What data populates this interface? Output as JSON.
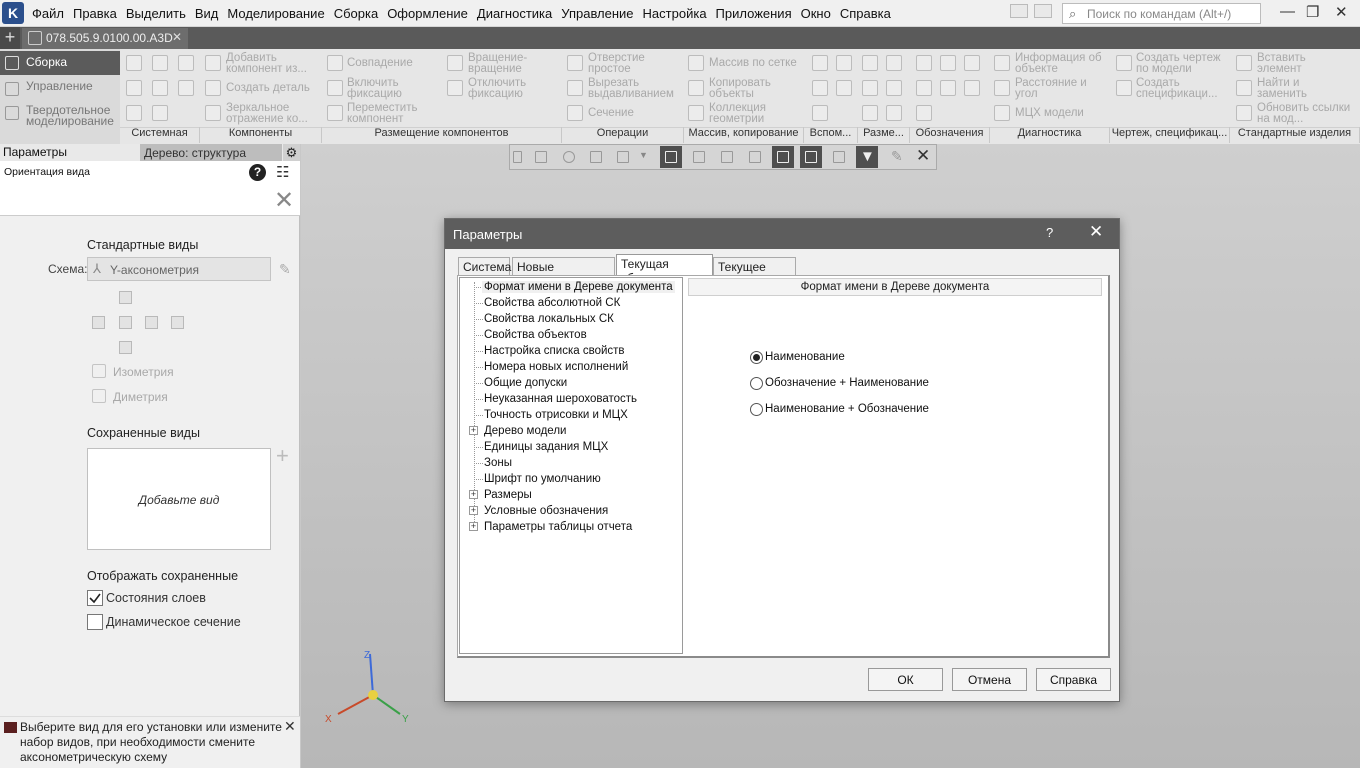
{
  "menubar": {
    "items": [
      "Файл",
      "Правка",
      "Выделить",
      "Вид",
      "Моделирование",
      "Сборка",
      "Оформление",
      "Диагностика",
      "Управление",
      "Настройка",
      "Приложения",
      "Окно",
      "Справка"
    ],
    "search_placeholder": "Поиск по командам (Alt+/)"
  },
  "doc_tab": {
    "label": "078.505.9.0100.00.A3D"
  },
  "leftnav": {
    "items": [
      "Сборка",
      "Управление",
      "Твердотельное моделирование"
    ]
  },
  "ribbon": {
    "commands": {
      "c1": "Добавить компонент из...",
      "c2": "Создать деталь",
      "c3": "Зеркальное отражение ко...",
      "c4": "Совпадение",
      "c5": "Включить фиксацию",
      "c6": "Переместить компонент",
      "c7": "Вращение-вращение",
      "c8": "Отключить фиксацию",
      "c9": "Отверстие простое",
      "c10": "Вырезать выдавливанием",
      "c11": "Сечение",
      "c12": "Массив по сетке",
      "c13": "Копировать объекты",
      "c14": "Коллекция геометрии",
      "c15": "Информация об объекте",
      "c16": "Расстояние и угол",
      "c17": "МЦХ модели",
      "c18": "Создать чертеж по модели",
      "c19": "Создать спецификаци...",
      "c20": "Вставить элемент",
      "c21": "Найти и заменить",
      "c22": "Обновить ссылки на мод..."
    },
    "groups": [
      "Системная",
      "Компоненты",
      "Размещение компонентов",
      "Операции",
      "Массив, копирование",
      "Вспом...",
      "Разме...",
      "Обозначения",
      "Диагностика",
      "Чертеж, спецификац...",
      "Стандартные изделия"
    ]
  },
  "left_panel": {
    "title": "Параметры",
    "tree_tab": "Дерево: структура",
    "subtitle": "Ориентация вида",
    "std_views": "Стандартные виды",
    "schema_label": "Схема:",
    "schema_value": "Y-аксонометрия",
    "isometry": "Изометрия",
    "dimetry": "Диметрия",
    "saved_views": "Сохраненные виды",
    "add_view": "Добавьте вид",
    "show_saved": "Отображать сохраненные",
    "cb_layers": "Состояния слоев",
    "cb_dynamic": "Динамическое сечение",
    "hint": "Выберите вид для его установки или измените набор видов, при необходимости смените аксонометрическую схему"
  },
  "axes": {
    "x": "X",
    "y": "Y",
    "z": "Z"
  },
  "dialog": {
    "title": "Параметры",
    "help": "?",
    "tabs": [
      "Система",
      "Новые документы",
      "Текущая сборка",
      "Текущее окно"
    ],
    "tree": [
      "Формат имени в Дереве документа",
      "Свойства абсолютной СК",
      "Свойства локальных СК",
      "Свойства объектов",
      "Настройка списка свойств",
      "Номера новых исполнений",
      "Общие допуски",
      "Неуказанная шероховатость",
      "Точность отрисовки и МЦХ",
      "Дерево модели",
      "Единицы задания МЦХ",
      "Зоны",
      "Шрифт по умолчанию",
      "Размеры",
      "Условные обозначения",
      "Параметры таблицы отчета"
    ],
    "prop_title": "Формат имени в Дереве документа",
    "options": [
      "Наименование",
      "Обозначение + Наименование",
      "Наименование + Обозначение"
    ],
    "selected_option": 0,
    "ok": "ОК",
    "cancel": "Отмена",
    "help_btn": "Справка"
  }
}
